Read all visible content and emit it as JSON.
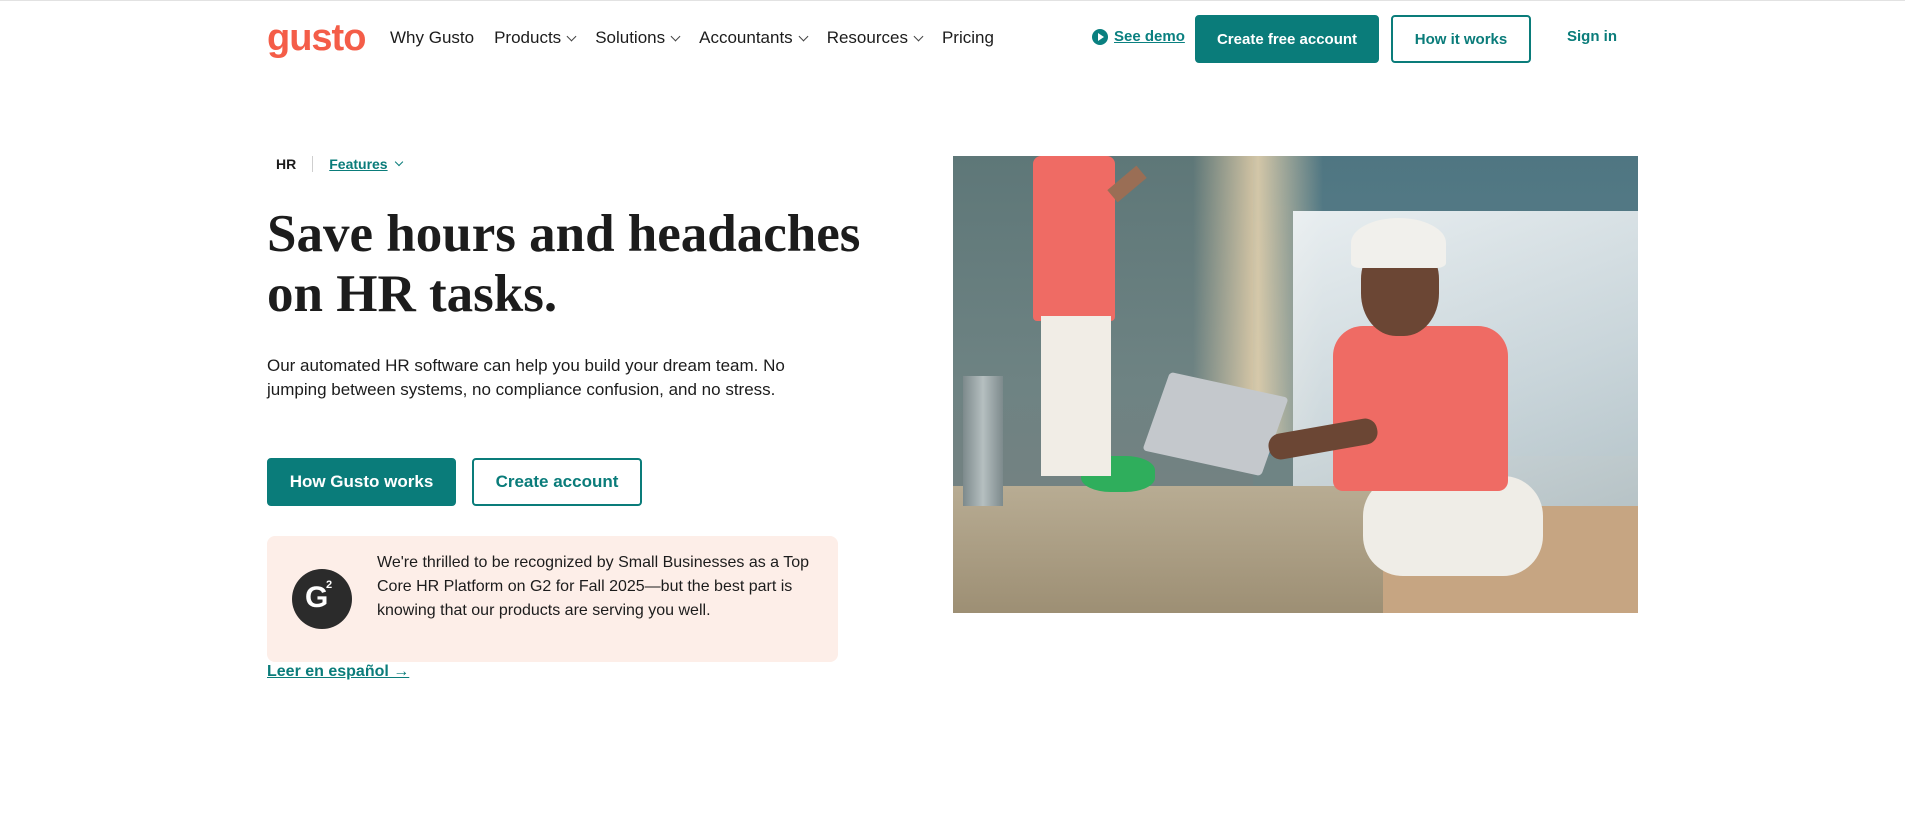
{
  "nav": {
    "logo": "gusto",
    "links": [
      {
        "label": "Why Gusto",
        "dropdown": false
      },
      {
        "label": "Products",
        "dropdown": true
      },
      {
        "label": "Solutions",
        "dropdown": true
      },
      {
        "label": "Accountants",
        "dropdown": true
      },
      {
        "label": "Resources",
        "dropdown": true
      },
      {
        "label": "Pricing",
        "dropdown": false
      }
    ],
    "see_demo": "See demo",
    "create_account": "Create free account",
    "how_it_works": "How it works",
    "sign_in": "Sign in"
  },
  "breadcrumb": {
    "current": "HR",
    "features": "Features"
  },
  "hero": {
    "headline": "Save hours and headaches on HR tasks.",
    "subtext": "Our automated HR software can help you build your dream team. No jumping between systems, no compliance confusion, and no stress.",
    "primary_button": "How Gusto works",
    "secondary_button": "Create account"
  },
  "award": {
    "badge": "G",
    "badge_sup": "2",
    "text": "We're thrilled to be recognized by Small Businesses as a Top Core HR Platform on G2 for Fall 2025—but the best part is knowing that our products are serving you well."
  },
  "spanish_link": "Leer en español →",
  "colors": {
    "brand": "#f45d48",
    "accent": "#0a7c7a",
    "award_bg": "#fdeee8"
  }
}
